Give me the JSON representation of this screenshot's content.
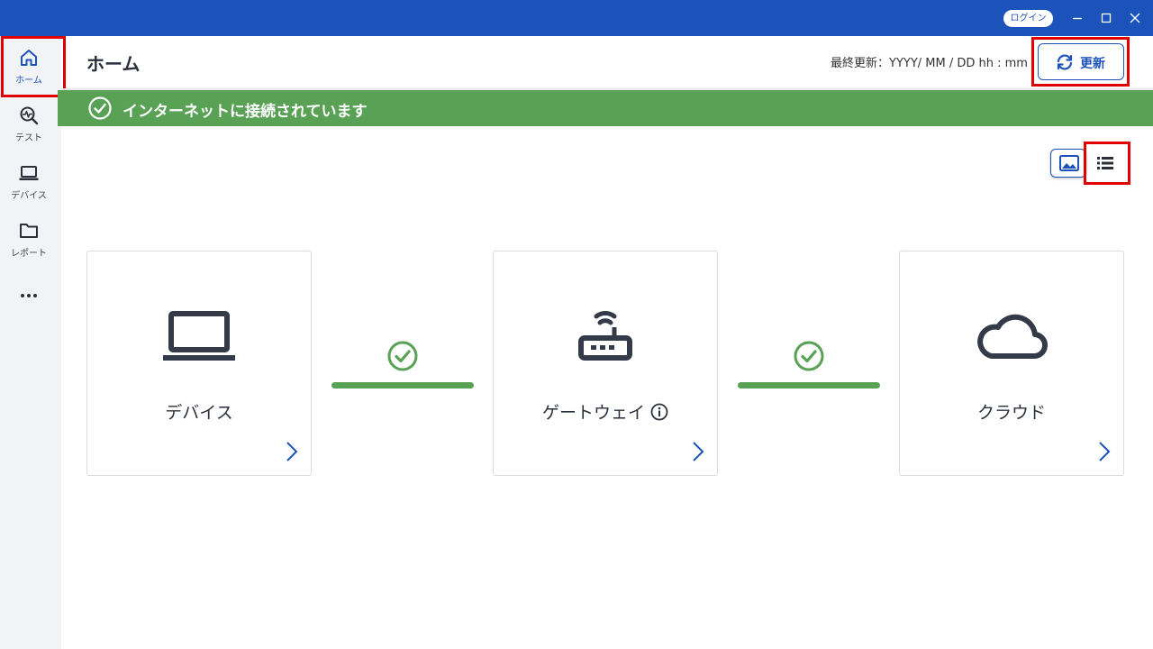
{
  "titlebar": {
    "login_label": "ログイン",
    "minimize_icon": "minimize-icon",
    "maximize_icon": "maximize-icon",
    "close_icon": "close-icon",
    "bg_color": "#1c53bb"
  },
  "sidebar": {
    "items": [
      {
        "label": "ホーム",
        "icon": "home-icon",
        "active": true
      },
      {
        "label": "テスト",
        "icon": "test-icon"
      },
      {
        "label": "デバイス",
        "icon": "laptop-icon"
      },
      {
        "label": "レポート",
        "icon": "folder-icon"
      }
    ],
    "more_icon": "more-icon"
  },
  "header": {
    "title": "ホーム",
    "last_updated": "最終更新：YYYY/ MM / DD hh : mm",
    "refresh_label": "更新"
  },
  "banner": {
    "text": "インターネットに接続されています",
    "color": "#58a155"
  },
  "view_toggle": {
    "image_view_icon": "image-view-icon",
    "list_view_icon": "list-view-icon"
  },
  "cards": [
    {
      "label": "デバイス",
      "icon": "laptop-icon"
    },
    {
      "label": "ゲートウェイ",
      "icon": "router-icon",
      "info_icon": "info-icon"
    },
    {
      "label": "クラウド",
      "icon": "cloud-icon"
    }
  ],
  "connections": [
    {
      "status": "connected",
      "icon": "check-circle-icon"
    },
    {
      "status": "connected",
      "icon": "check-circle-icon"
    }
  ],
  "colors": {
    "accent": "#1c53bb",
    "success": "#58a155",
    "highlight": "#e00000",
    "sidebar_bg": "#f2f3f6"
  }
}
